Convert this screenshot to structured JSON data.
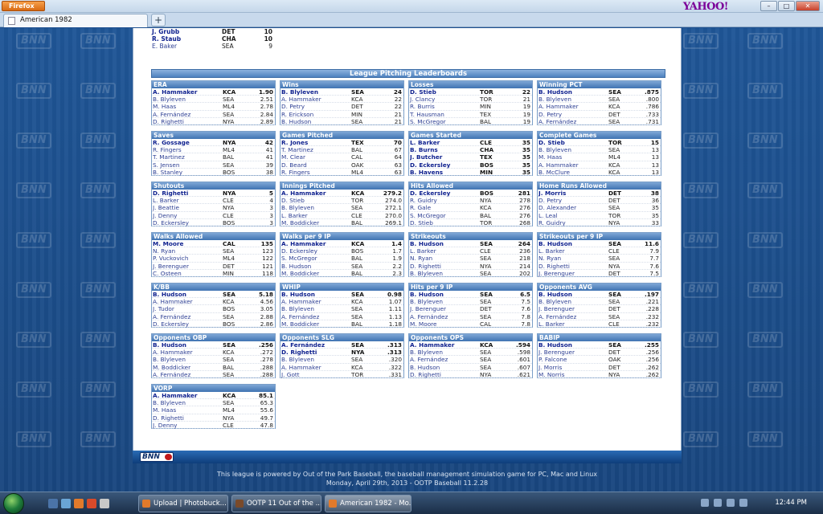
{
  "browser": {
    "menu_label": "Firefox",
    "tab_title": "American 1982",
    "new_tab": "+",
    "search_brand": "YAHOO!",
    "controls": [
      "–",
      "□",
      "✕"
    ]
  },
  "top_rows": [
    {
      "name": "J. Grubb",
      "team": "DET",
      "value": "10",
      "lead": true
    },
    {
      "name": "R. Staub",
      "team": "CHA",
      "value": "10",
      "lead": true
    },
    {
      "name": "E. Baker",
      "team": "SEA",
      "value": "9",
      "lead": false
    }
  ],
  "section_title": "League Pitching Leaderboards",
  "boards": [
    {
      "title": "ERA",
      "rows": [
        [
          "A. Hammaker",
          "KCA",
          "1.90"
        ],
        [
          "B. Blyleven",
          "SEA",
          "2.51"
        ],
        [
          "M. Haas",
          "ML4",
          "2.78"
        ],
        [
          "A. Fernández",
          "SEA",
          "2.84"
        ],
        [
          "D. Righetti",
          "NYA",
          "2.89"
        ]
      ]
    },
    {
      "title": "Wins",
      "rows": [
        [
          "B. Blyleven",
          "SEA",
          "24"
        ],
        [
          "A. Hammaker",
          "KCA",
          "22"
        ],
        [
          "D. Petry",
          "DET",
          "22"
        ],
        [
          "R. Erickson",
          "MIN",
          "21"
        ],
        [
          "B. Hudson",
          "SEA",
          "21"
        ]
      ]
    },
    {
      "title": "Losses",
      "rows": [
        [
          "D. Stieb",
          "TOR",
          "22"
        ],
        [
          "J. Clancy",
          "TOR",
          "21"
        ],
        [
          "R. Burris",
          "MIN",
          "19"
        ],
        [
          "T. Hausman",
          "TEX",
          "19"
        ],
        [
          "S. McGregor",
          "BAL",
          "19"
        ]
      ]
    },
    {
      "title": "Winning PCT",
      "rows": [
        [
          "B. Hudson",
          "SEA",
          ".875"
        ],
        [
          "B. Blyleven",
          "SEA",
          ".800"
        ],
        [
          "A. Hammaker",
          "KCA",
          ".786"
        ],
        [
          "D. Petry",
          "DET",
          ".733"
        ],
        [
          "A. Fernández",
          "SEA",
          ".731"
        ]
      ]
    },
    {
      "title": "Saves",
      "rows": [
        [
          "R. Gossage",
          "NYA",
          "42"
        ],
        [
          "R. Fingers",
          "ML4",
          "41"
        ],
        [
          "T. Martinez",
          "BAL",
          "41"
        ],
        [
          "S. Jensen",
          "SEA",
          "39"
        ],
        [
          "B. Stanley",
          "BOS",
          "38"
        ]
      ]
    },
    {
      "title": "Games Pitched",
      "rows": [
        [
          "R. Jones",
          "TEX",
          "70"
        ],
        [
          "T. Martinez",
          "BAL",
          "67"
        ],
        [
          "M. Clear",
          "CAL",
          "64"
        ],
        [
          "D. Beard",
          "OAK",
          "63"
        ],
        [
          "R. Fingers",
          "ML4",
          "63"
        ]
      ]
    },
    {
      "title": "Games Started",
      "rows": [
        [
          "L. Barker",
          "CLE",
          "35"
        ],
        [
          "B. Burns",
          "CHA",
          "35"
        ],
        [
          "J. Butcher",
          "TEX",
          "35"
        ],
        [
          "D. Eckersley",
          "BOS",
          "35"
        ],
        [
          "B. Havens",
          "MIN",
          "35"
        ]
      ],
      "bold_count": 5
    },
    {
      "title": "Complete Games",
      "rows": [
        [
          "D. Stieb",
          "TOR",
          "15"
        ],
        [
          "B. Blyleven",
          "SEA",
          "13"
        ],
        [
          "M. Haas",
          "ML4",
          "13"
        ],
        [
          "A. Hammaker",
          "KCA",
          "13"
        ],
        [
          "B. McClure",
          "KCA",
          "13"
        ]
      ]
    },
    {
      "title": "Shutouts",
      "rows": [
        [
          "D. Righetti",
          "NYA",
          "5"
        ],
        [
          "L. Barker",
          "CLE",
          "4"
        ],
        [
          "J. Beattie",
          "NYA",
          "3"
        ],
        [
          "J. Denny",
          "CLE",
          "3"
        ],
        [
          "D. Eckersley",
          "BOS",
          "3"
        ]
      ]
    },
    {
      "title": "Innings Pitched",
      "rows": [
        [
          "A. Hammaker",
          "KCA",
          "279.2"
        ],
        [
          "D. Stieb",
          "TOR",
          "274.0"
        ],
        [
          "B. Blyleven",
          "SEA",
          "272.1"
        ],
        [
          "L. Barker",
          "CLE",
          "270.0"
        ],
        [
          "M. Boddicker",
          "BAL",
          "269.1"
        ]
      ]
    },
    {
      "title": "Hits Allowed",
      "rows": [
        [
          "D. Eckersley",
          "BOS",
          "281"
        ],
        [
          "R. Guidry",
          "NYA",
          "278"
        ],
        [
          "R. Gale",
          "KCA",
          "276"
        ],
        [
          "S. McGregor",
          "BAL",
          "276"
        ],
        [
          "D. Stieb",
          "TOR",
          "268"
        ]
      ]
    },
    {
      "title": "Home Runs Allowed",
      "rows": [
        [
          "J. Morris",
          "DET",
          "38"
        ],
        [
          "D. Petry",
          "DET",
          "36"
        ],
        [
          "D. Alexander",
          "SEA",
          "35"
        ],
        [
          "L. Leal",
          "TOR",
          "35"
        ],
        [
          "R. Guidry",
          "NYA",
          "33"
        ]
      ]
    },
    {
      "title": "Walks Allowed",
      "rows": [
        [
          "M. Moore",
          "CAL",
          "135"
        ],
        [
          "N. Ryan",
          "SEA",
          "123"
        ],
        [
          "P. Vuckovich",
          "ML4",
          "122"
        ],
        [
          "J. Berenguer",
          "DET",
          "121"
        ],
        [
          "C. Osteen",
          "MIN",
          "118"
        ]
      ]
    },
    {
      "title": "Walks per 9 IP",
      "rows": [
        [
          "A. Hammaker",
          "KCA",
          "1.4"
        ],
        [
          "D. Eckersley",
          "BOS",
          "1.7"
        ],
        [
          "S. McGregor",
          "BAL",
          "1.9"
        ],
        [
          "B. Hudson",
          "SEA",
          "2.2"
        ],
        [
          "M. Boddicker",
          "BAL",
          "2.3"
        ]
      ]
    },
    {
      "title": "Strikeouts",
      "rows": [
        [
          "B. Hudson",
          "SEA",
          "264"
        ],
        [
          "L. Barker",
          "CLE",
          "236"
        ],
        [
          "N. Ryan",
          "SEA",
          "218"
        ],
        [
          "D. Righetti",
          "NYA",
          "214"
        ],
        [
          "B. Blyleven",
          "SEA",
          "202"
        ]
      ]
    },
    {
      "title": "Strikeouts per 9 IP",
      "rows": [
        [
          "B. Hudson",
          "SEA",
          "11.6"
        ],
        [
          "L. Barker",
          "CLE",
          "7.9"
        ],
        [
          "N. Ryan",
          "SEA",
          "7.7"
        ],
        [
          "D. Righetti",
          "NYA",
          "7.6"
        ],
        [
          "J. Berenguer",
          "DET",
          "7.5"
        ]
      ]
    },
    {
      "title": "K/BB",
      "rows": [
        [
          "B. Hudson",
          "SEA",
          "5.18"
        ],
        [
          "A. Hammaker",
          "KCA",
          "4.56"
        ],
        [
          "J. Tudor",
          "BOS",
          "3.05"
        ],
        [
          "A. Fernández",
          "SEA",
          "2.88"
        ],
        [
          "D. Eckersley",
          "BOS",
          "2.86"
        ]
      ]
    },
    {
      "title": "WHIP",
      "rows": [
        [
          "B. Hudson",
          "SEA",
          "0.98"
        ],
        [
          "A. Hammaker",
          "KCA",
          "1.07"
        ],
        [
          "B. Blyleven",
          "SEA",
          "1.11"
        ],
        [
          "A. Fernández",
          "SEA",
          "1.13"
        ],
        [
          "M. Boddicker",
          "BAL",
          "1.18"
        ]
      ]
    },
    {
      "title": "Hits per 9 IP",
      "rows": [
        [
          "B. Hudson",
          "SEA",
          "6.5"
        ],
        [
          "B. Blyleven",
          "SEA",
          "7.5"
        ],
        [
          "J. Berenguer",
          "DET",
          "7.6"
        ],
        [
          "A. Fernández",
          "SEA",
          "7.8"
        ],
        [
          "M. Moore",
          "CAL",
          "7.8"
        ]
      ]
    },
    {
      "title": "Opponents AVG",
      "rows": [
        [
          "B. Hudson",
          "SEA",
          ".197"
        ],
        [
          "B. Blyleven",
          "SEA",
          ".221"
        ],
        [
          "J. Berenguer",
          "DET",
          ".228"
        ],
        [
          "A. Fernández",
          "SEA",
          ".232"
        ],
        [
          "L. Barker",
          "CLE",
          ".232"
        ]
      ]
    },
    {
      "title": "Opponents OBP",
      "rows": [
        [
          "B. Hudson",
          "SEA",
          ".256"
        ],
        [
          "A. Hammaker",
          "KCA",
          ".272"
        ],
        [
          "B. Blyleven",
          "SEA",
          ".278"
        ],
        [
          "M. Boddicker",
          "BAL",
          ".288"
        ],
        [
          "A. Fernández",
          "SEA",
          ".288"
        ]
      ]
    },
    {
      "title": "Opponents SLG",
      "rows": [
        [
          "A. Fernández",
          "SEA",
          ".313"
        ],
        [
          "D. Righetti",
          "NYA",
          ".313"
        ],
        [
          "B. Blyleven",
          "SEA",
          ".320"
        ],
        [
          "A. Hammaker",
          "KCA",
          ".322"
        ],
        [
          "J. Gott",
          "TOR",
          ".331"
        ]
      ],
      "bold_count": 2
    },
    {
      "title": "Opponents OPS",
      "rows": [
        [
          "A. Hammaker",
          "KCA",
          ".594"
        ],
        [
          "B. Blyleven",
          "SEA",
          ".598"
        ],
        [
          "A. Fernández",
          "SEA",
          ".601"
        ],
        [
          "B. Hudson",
          "SEA",
          ".607"
        ],
        [
          "D. Righetti",
          "NYA",
          ".621"
        ]
      ]
    },
    {
      "title": "BABIP",
      "rows": [
        [
          "B. Hudson",
          "SEA",
          ".255"
        ],
        [
          "J. Berenguer",
          "DET",
          ".256"
        ],
        [
          "P. Falcone",
          "OAK",
          ".256"
        ],
        [
          "J. Morris",
          "DET",
          ".262"
        ],
        [
          "M. Norris",
          "NYA",
          ".262"
        ]
      ]
    },
    {
      "title": "VORP",
      "rows": [
        [
          "A. Hammaker",
          "KCA",
          "85.1"
        ],
        [
          "B. Blyleven",
          "SEA",
          "65.3"
        ],
        [
          "M. Haas",
          "ML4",
          "55.6"
        ],
        [
          "D. Righetti",
          "NYA",
          "49.7"
        ],
        [
          "J. Denny",
          "CLE",
          "47.8"
        ]
      ]
    }
  ],
  "bottom_logo": "BNN",
  "watermark": "BNN",
  "footer": {
    "line1": "This league is powered by Out of the Park Baseball, the baseball management simulation game for PC, Mac and Linux",
    "line2": "Monday, April 29th, 2013 - OOTP Baseball 11.2.28"
  },
  "taskbar": {
    "tasks": [
      "Upload | Photobuck...",
      "OOTP 11 Out of the ...",
      "American 1982 - Mo..."
    ],
    "clock": "12:44 PM"
  }
}
